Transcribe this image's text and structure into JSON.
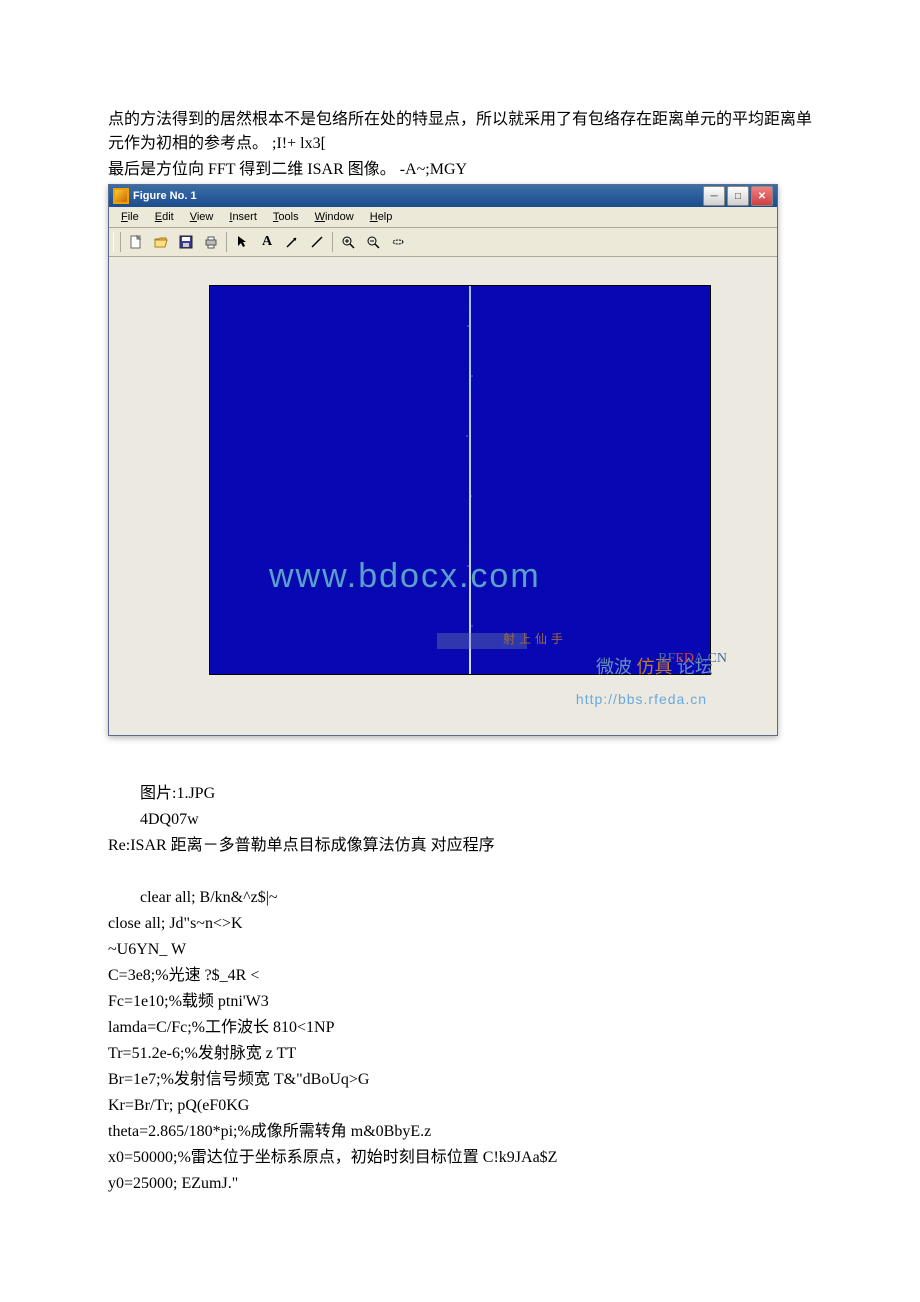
{
  "doc": {
    "p1": "点的方法得到的居然根本不是包络所在处的特显点，所以就采用了有包络存在距离单元的平均距离单元作为初相的参考点。 ;I!+ lx3[",
    "p2": "最后是方位向 FFT 得到二维 ISAR 图像。 -A~;MGY",
    "img_label": "图片:1.JPG",
    "p3": "4DQ07w",
    "p4": "Re:ISAR 距离－多普勒单点目标成像算法仿真 对应程序",
    "code": [
      "clear all; B/kn&^z$|~",
      "close all; Jd\"s~n<>K",
      "~U6YN_ W",
      "C=3e8;%光速 ?$_4R <",
      "Fc=1e10;%载频 ptni'W3",
      "lamda=C/Fc;%工作波长 810<1NP",
      "Tr=51.2e-6;%发射脉宽 z TT",
      "Br=1e7;%发射信号频宽 T&\"dBoUq>G",
      "Kr=Br/Tr; pQ(eF0KG",
      "theta=2.865/180*pi;%成像所需转角 m&0BbyE.z",
      "x0=50000;%雷达位于坐标系原点，初始时刻目标位置 C!k9JAa$Z",
      "y0=25000; EZumJ.\""
    ]
  },
  "figure": {
    "title": "Figure No. 1",
    "menu": {
      "file": "File",
      "edit": "Edit",
      "view": "View",
      "insert": "Insert",
      "tools": "Tools",
      "window": "Window",
      "help": "Help"
    },
    "watermark_url": "www.bdocx.com",
    "watermark_site": "http://bbs.rfeda.cn",
    "watermark_brand": "RFEDA.CN",
    "watermark_cn1": "微波",
    "watermark_cn2": "仿真",
    "watermark_cn3": "论坛",
    "watermark_top": "射上仙手"
  },
  "chart_data": {
    "type": "heatmap",
    "title": "",
    "xlabel": "",
    "ylabel": "",
    "xlim": [
      0,
      650
    ],
    "ylim": [
      0,
      130
    ],
    "xticks": [
      100,
      200,
      300,
      400,
      500,
      600
    ],
    "yticks": [
      20,
      40,
      60,
      80,
      100,
      120
    ],
    "note": "Dark blue field with a thin vertical bright streak near x≈330 spanning full y-range"
  }
}
